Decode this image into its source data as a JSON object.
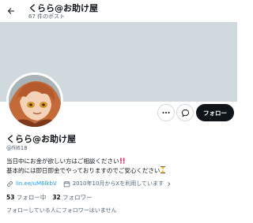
{
  "header": {
    "title": "くらら@お助け屋",
    "post_count": "67 件のポスト"
  },
  "profile": {
    "display_name": "くらら@お助け屋",
    "handle": "@fil618",
    "bio_line1": "当日中にお金が欲しい方はご相談ください",
    "bio_line2": "基本的には即日即金でやっておりますのでご安心ください",
    "link": "lin.ee/uM6lkbV",
    "joined": "2010年10月からXを利用しています",
    "following_count": "53",
    "following_label": "フォロー中",
    "followers_count": "32",
    "followers_label": "フォロワー",
    "followers_you_know": "フォローしている人にフォロワーはいません"
  },
  "actions": {
    "follow_label": "フォロー"
  },
  "icons": {
    "back": "back-arrow-icon",
    "more": "more-dots-icon",
    "message": "message-icon",
    "link": "link-icon",
    "calendar": "calendar-icon",
    "joined_more": "chevron-right-icon"
  },
  "colors": {
    "banner": "#cfd9de",
    "accent": "#1d9bf0",
    "follow_button": "#0f1419",
    "secondary_text": "#536471"
  }
}
